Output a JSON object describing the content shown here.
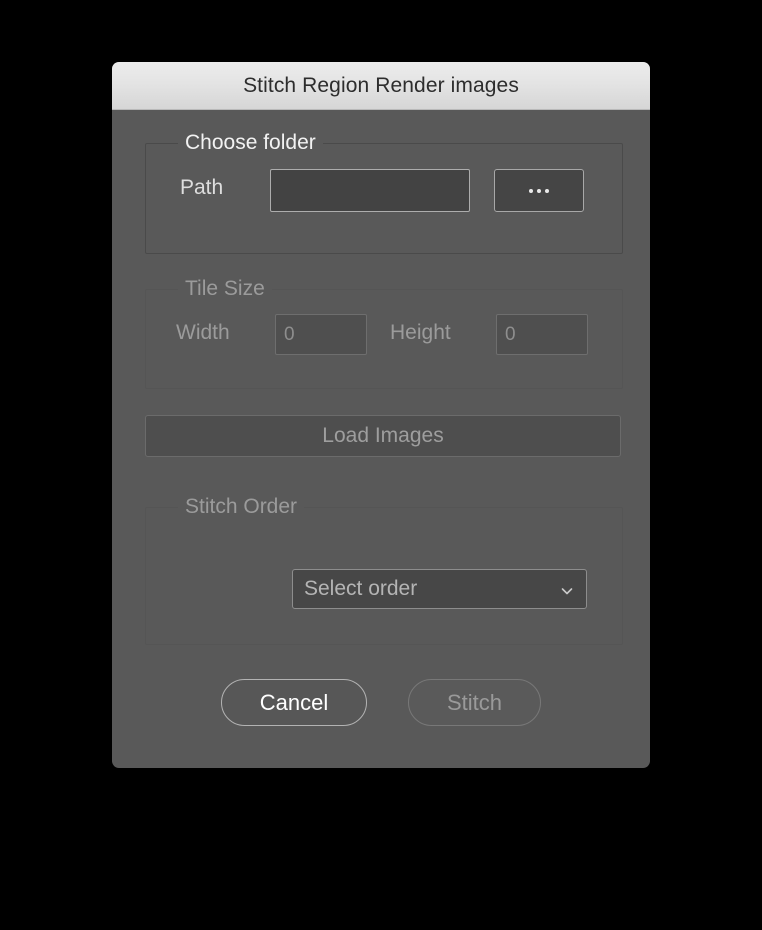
{
  "window": {
    "title": "Stitch Region Render images"
  },
  "colors": {
    "dialog_background": "#595959",
    "titlebar_top": "#ececec",
    "titlebar_bottom": "#d6d6d6",
    "titlebar_text": "#2d2d2d",
    "enabled_text": "#f2f2f2",
    "disabled_text": "#9b9b9b",
    "input_background": "#434343",
    "input_border": "#adadad",
    "disabled_input_background": "#4f4f4f",
    "group_border": "#4a4a4a",
    "primary_button_text": "#ffffff"
  },
  "groups": {
    "choose_folder": {
      "title": "Choose folder",
      "enabled": true,
      "path_label": "Path",
      "path_value": "",
      "path_placeholder": "",
      "browse_button_label": "..."
    },
    "tile_size": {
      "title": "Tile Size",
      "enabled": false,
      "width_label": "Width",
      "width_value": "0",
      "height_label": "Height",
      "height_value": "0"
    },
    "stitch_order": {
      "title": "Stitch Order",
      "enabled": false,
      "select_value": "Select order",
      "select_options": [
        "Select order"
      ]
    }
  },
  "load_images_button": {
    "label": "Load Images",
    "enabled": false
  },
  "footer": {
    "cancel_label": "Cancel",
    "stitch_label": "Stitch",
    "cancel_enabled": true,
    "stitch_enabled": false
  }
}
